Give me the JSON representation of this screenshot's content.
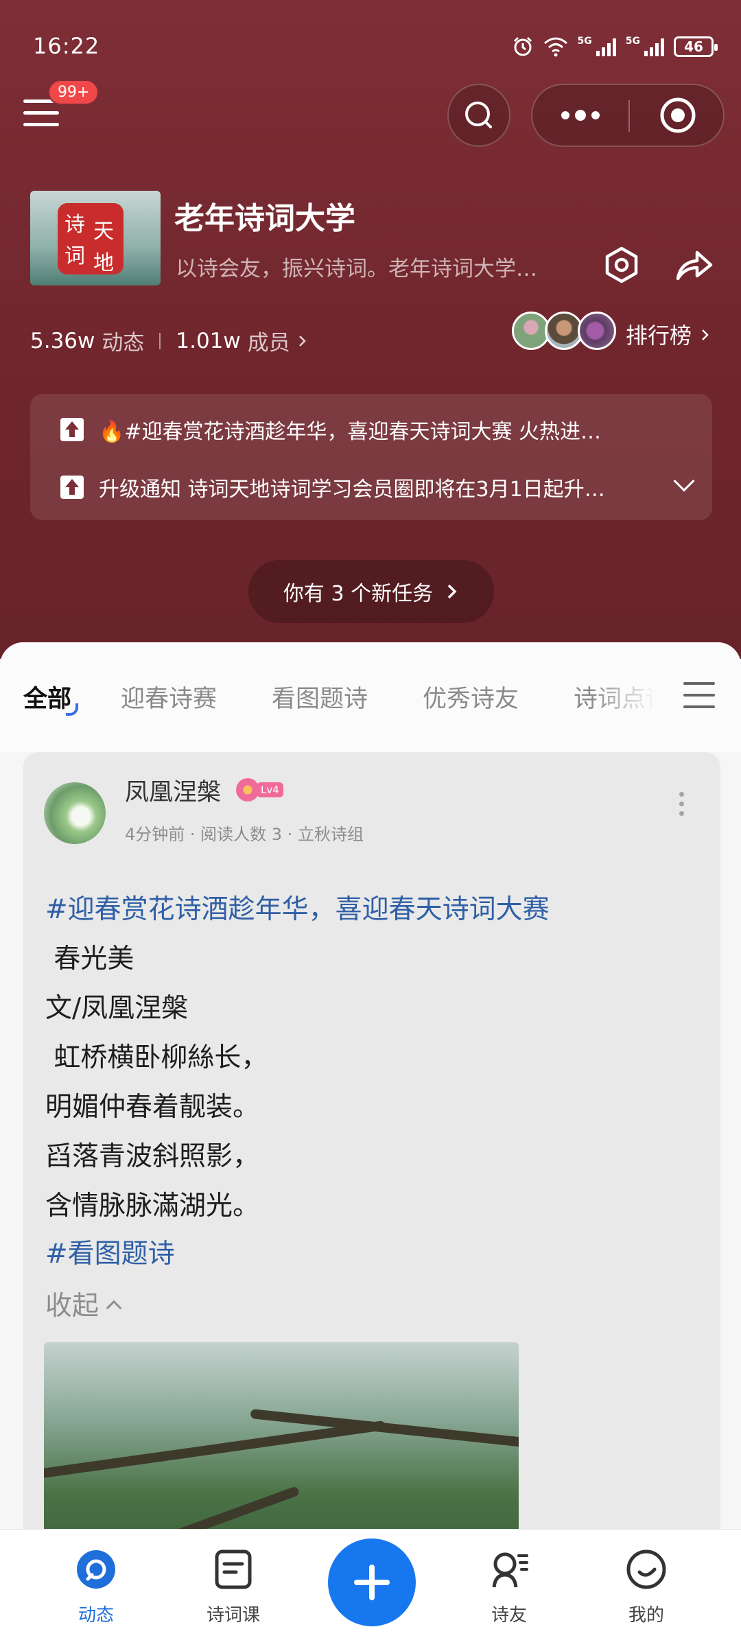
{
  "status_bar": {
    "time": "16:22",
    "network_1": "5G",
    "network_2": "5G",
    "battery": "46"
  },
  "header": {
    "notification_badge": "99+"
  },
  "group": {
    "logo_text": [
      "诗",
      "词",
      "天",
      "地"
    ],
    "title": "老年诗词大学",
    "description": "以诗会友，振兴诗词。老年诗词大学…",
    "posts_count": "5.36w",
    "posts_label": "动态",
    "members_count": "1.01w",
    "members_label": "成员",
    "rank_label": "排行榜"
  },
  "notices": [
    {
      "text": "🔥#迎春赏花诗酒趁年华，喜迎春天诗词大赛 火热进…"
    },
    {
      "text": "升级通知 诗词天地诗词学习会员圈即将在3月1日起升…"
    }
  ],
  "task_banner": "你有 3 个新任务",
  "tabs": [
    "全部",
    "迎春诗赛",
    "看图题诗",
    "优秀诗友",
    "诗词点评"
  ],
  "post": {
    "author": "凤凰涅槃",
    "level": "Lv4",
    "meta": "4分钟前 · 阅读人数 3 · 立秋诗组",
    "hashtag_1": "#迎春赏花诗酒趁年华，喜迎春天诗词大赛",
    "lines": [
      " 春光美",
      "文/凤凰涅槃",
      " 虹桥横卧柳絲长，",
      "明媚仲春着靓装。",
      "舀落青波斜照影，",
      "含情脉脉滿湖光。"
    ],
    "hashtag_2": "#看图题诗",
    "collapse_label": "收起"
  },
  "bottom_nav": [
    {
      "label": "动态",
      "icon": "feed-icon",
      "active": true
    },
    {
      "label": "诗词课",
      "icon": "course-icon",
      "active": false
    },
    {
      "label": "诗友",
      "icon": "friends-icon",
      "active": false
    },
    {
      "label": "我的",
      "icon": "profile-icon",
      "active": false
    }
  ],
  "colors": {
    "header_bg": "#7e2e36",
    "accent": "#1677ef",
    "hashtag": "#2f5fa6",
    "badge": "#f04848"
  }
}
